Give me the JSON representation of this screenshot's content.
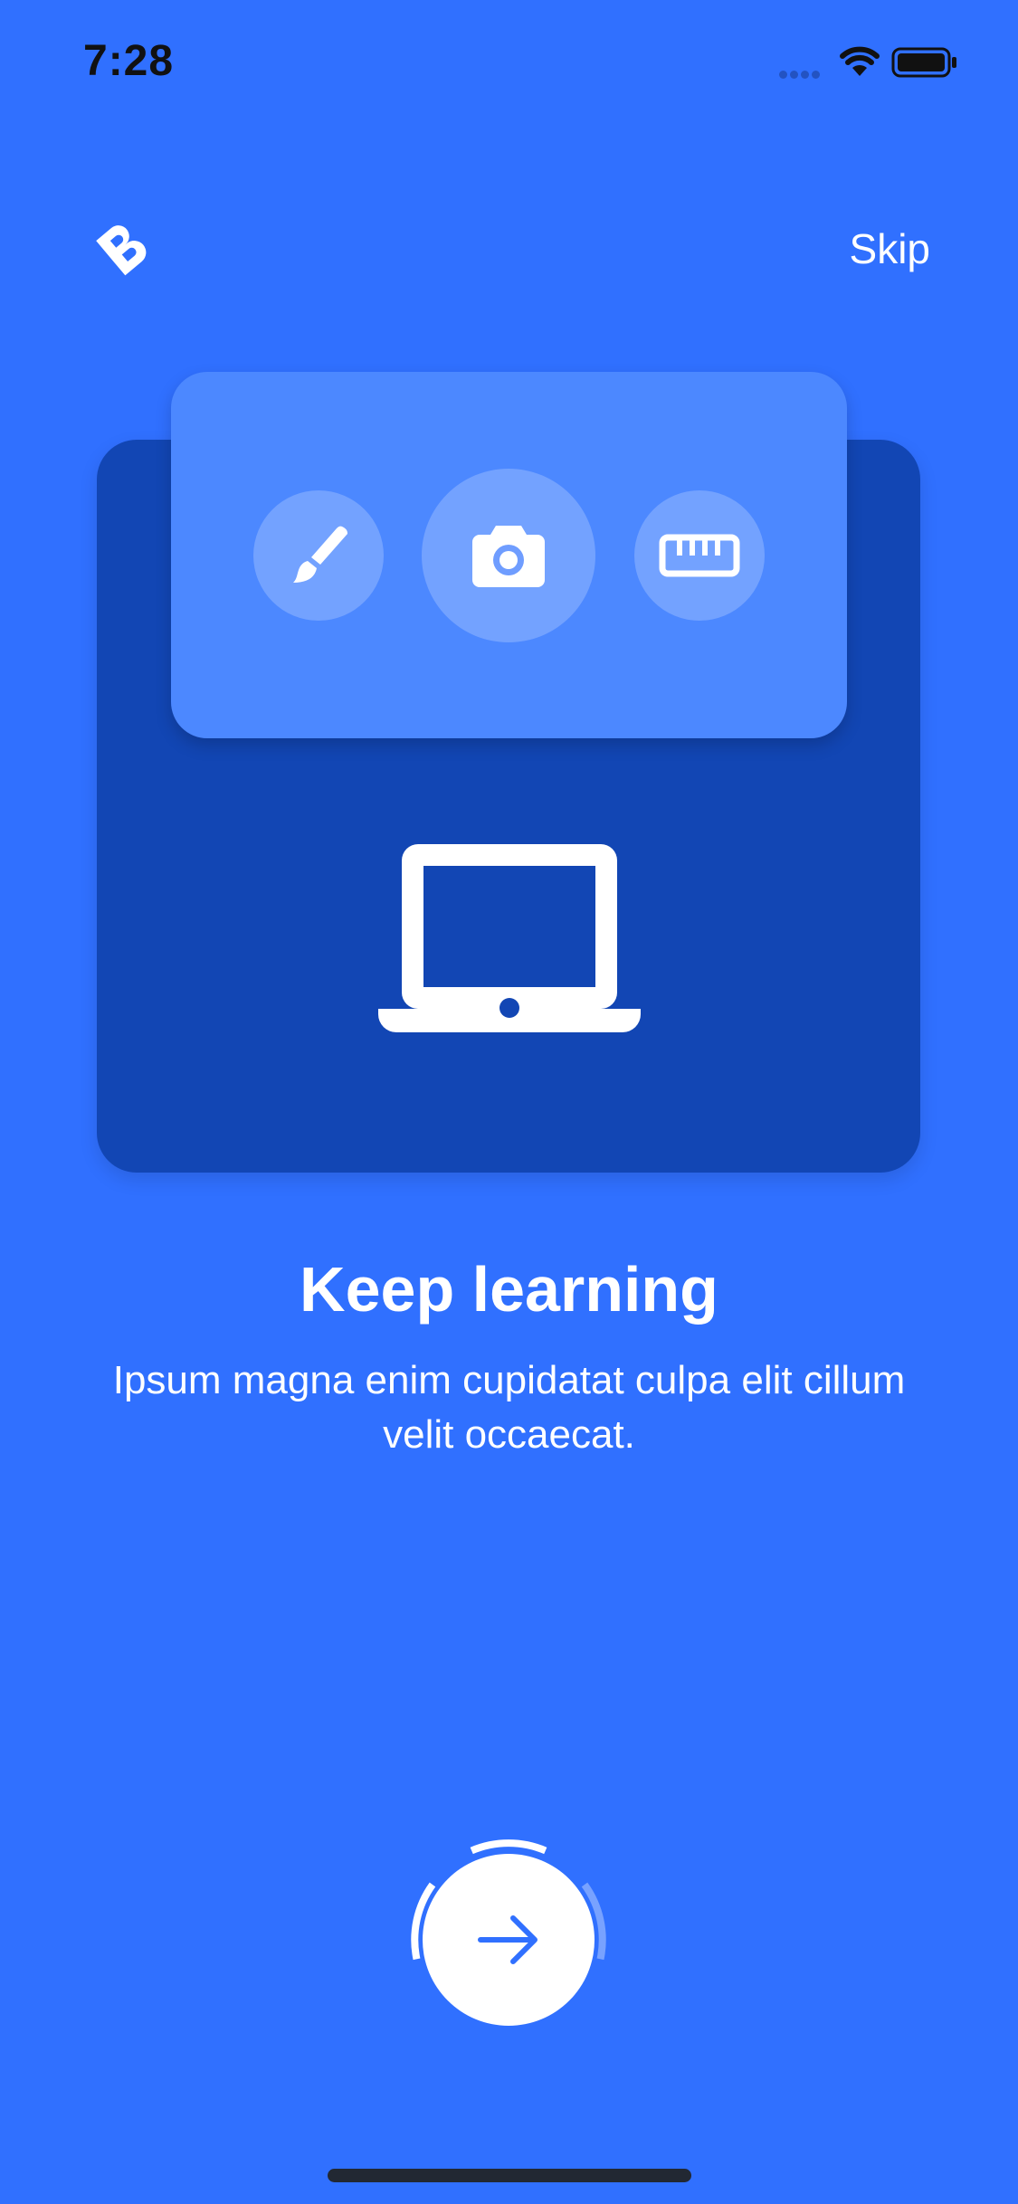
{
  "status_bar": {
    "time": "7:28"
  },
  "header": {
    "logo_icon": "b-logo-icon",
    "skip_label": "Skip"
  },
  "illustration": {
    "tool_icons": [
      "brush-icon",
      "camera-icon",
      "ruler-icon"
    ],
    "device_icon": "laptop-icon"
  },
  "content": {
    "title": "Keep learning",
    "description": "Ipsum magna enim cupidatat culpa elit cillum velit occaecat."
  },
  "onboarding": {
    "next_icon": "arrow-right-icon"
  },
  "colors": {
    "background": "#3070FF",
    "back_card": "#1246B4",
    "front_card": "#4C88FF",
    "accent": "#3070FF"
  }
}
